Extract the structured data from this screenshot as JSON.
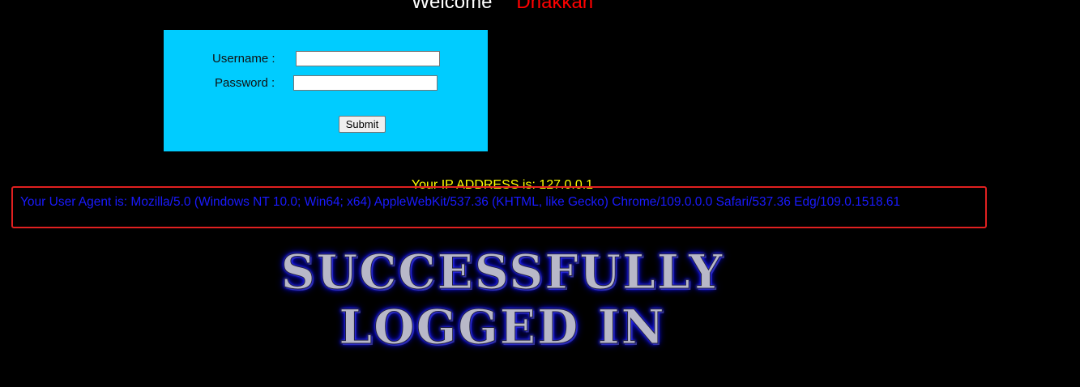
{
  "header": {
    "welcome": "Welcome",
    "name": "Dhakkan"
  },
  "login_form": {
    "username_label": "Username :",
    "username_value": "",
    "password_label": "Password :",
    "password_value": "",
    "submit_label": "Submit"
  },
  "info": {
    "ip_address": "Your IP ADDRESS is: 127.0.0.1",
    "user_agent": "Your User Agent is: Mozilla/5.0 (Windows NT 10.0; Win64; x64) AppleWebKit/537.36 (KHTML, like Gecko) Chrome/109.0.0.0 Safari/537.36 Edg/109.0.1518.61"
  },
  "result": {
    "line1": "SUCCESSFULLY",
    "line2": "LOGGED IN"
  },
  "colors": {
    "background": "#000000",
    "form_bg": "#00ccff",
    "welcome": "#ffffff",
    "name": "#ff0000",
    "ip_text": "#ffff00",
    "ua_text": "#1a1aff",
    "highlight_border": "#e02020"
  }
}
